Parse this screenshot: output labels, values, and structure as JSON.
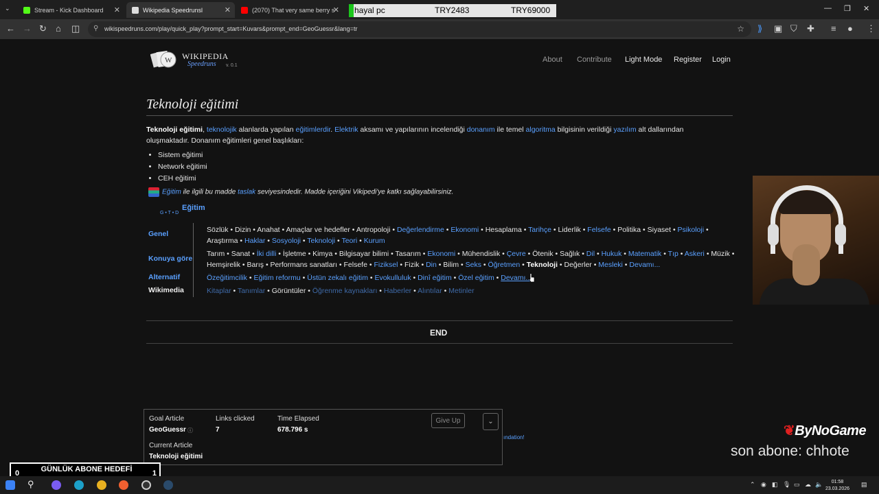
{
  "browser": {
    "tabs": [
      {
        "title": "Stream - Kick Dashboard",
        "favicon_color": "#53fc18"
      },
      {
        "title": "Wikipedia Speedrunsl",
        "favicon_color": "#dddddd"
      },
      {
        "title": "(2070) That very same berry sin",
        "favicon_color": "#ff0000"
      }
    ],
    "url": "wikispeedruns.com/play/quick_play?prompt_start=Kuvars&prompt_end=GeoGuessr&lang=tr"
  },
  "overlay_bar": {
    "label": "hayal pc",
    "value1": "TRY2483",
    "value2": "TRY69000"
  },
  "site": {
    "logo_title": "WIKIPEDIA",
    "logo_sub": "Speedruns",
    "version": "v. 0.1",
    "nav": [
      "About",
      "Contribute",
      "Light Mode",
      "Register",
      "Login"
    ]
  },
  "article": {
    "title": "Teknoloji eğitimi",
    "intro_line1": [
      {
        "t": "Teknoloji eğitimi",
        "s": "b"
      },
      {
        "t": ", "
      },
      {
        "t": "teknolojik",
        "s": "l"
      },
      {
        "t": " alanlarda yapılan "
      },
      {
        "t": "eğitimlerdir",
        "s": "l"
      },
      {
        "t": ". "
      },
      {
        "t": "Elektrik",
        "s": "l"
      },
      {
        "t": " aksamı ve yapılarının incelendiği "
      },
      {
        "t": "donanım",
        "s": "l"
      },
      {
        "t": " ile temel "
      },
      {
        "t": "algoritma",
        "s": "l"
      },
      {
        "t": " bilgisinin verildiği "
      },
      {
        "t": "yazılım",
        "s": "l"
      },
      {
        "t": " alt dallarından"
      }
    ],
    "intro_line2": "oluşmaktadır. Donanım eğitimleri genel başlıkları:",
    "bullets": [
      "Sistem eğitimi",
      "Network eğitimi",
      "CEH eğitimi"
    ],
    "stub": [
      {
        "t": "Eğitim",
        "s": "l"
      },
      {
        "t": " ile ilgili bu madde "
      },
      {
        "t": "taslak",
        "s": "l"
      },
      {
        "t": " seviyesindedir. Madde içeriğini Vikipedi'ye katkı sağlayabilirsiniz."
      }
    ],
    "navbox": {
      "title": "Eğitim",
      "vte": "G • T • D",
      "groups": [
        "Genel",
        "Konuya göre",
        "Alternatif",
        "Wikimedia"
      ],
      "lines": [
        [
          {
            "t": "Sözlük • Dizin • Anahat • Amaçlar ve hedefler • Antropoloji • "
          },
          {
            "t": "Değerlendirme",
            "s": "l"
          },
          {
            "t": " • "
          },
          {
            "t": "Ekonomi",
            "s": "l"
          },
          {
            "t": " • Hesaplama • "
          },
          {
            "t": "Tarihçe",
            "s": "l"
          },
          {
            "t": " • Liderlik • "
          },
          {
            "t": "Felsefe",
            "s": "l"
          },
          {
            "t": " • Politika • Siyaset • "
          },
          {
            "t": "Psikoloji",
            "s": "l"
          },
          {
            "t": " •"
          }
        ],
        [
          {
            "t": "Araştırma • "
          },
          {
            "t": "Haklar",
            "s": "l"
          },
          {
            "t": " • "
          },
          {
            "t": "Sosyoloji",
            "s": "l"
          },
          {
            "t": " • "
          },
          {
            "t": "Teknoloji",
            "s": "l"
          },
          {
            "t": " • "
          },
          {
            "t": "Teori",
            "s": "l"
          },
          {
            "t": " • "
          },
          {
            "t": "Kurum",
            "s": "l"
          }
        ],
        [
          {
            "t": "Tarım • Sanat • "
          },
          {
            "t": "İki dilli",
            "s": "l"
          },
          {
            "t": " • İşletme • Kimya • Bilgisayar bilimi • Tasarım • "
          },
          {
            "t": "Ekonomi",
            "s": "l"
          },
          {
            "t": " • Mühendislik • "
          },
          {
            "t": "Çevre",
            "s": "l"
          },
          {
            "t": " • Ötenik • Sağlık • "
          },
          {
            "t": "Dil",
            "s": "l"
          },
          {
            "t": " • "
          },
          {
            "t": "Hukuk",
            "s": "l"
          },
          {
            "t": " • "
          },
          {
            "t": "Matematik",
            "s": "l"
          },
          {
            "t": " • "
          },
          {
            "t": "Tıp",
            "s": "l"
          },
          {
            "t": " • "
          },
          {
            "t": "Askeri",
            "s": "l"
          },
          {
            "t": " • Müzik •"
          }
        ],
        [
          {
            "t": "Hemşirelik • Barış • Performans sanatları • Felsefe • "
          },
          {
            "t": "Fiziksel",
            "s": "l"
          },
          {
            "t": " • Fizik • "
          },
          {
            "t": "Din",
            "s": "l"
          },
          {
            "t": " • Bilim • "
          },
          {
            "t": "Seks",
            "s": "l"
          },
          {
            "t": " • "
          },
          {
            "t": "Öğretmen",
            "s": "l"
          },
          {
            "t": " • "
          },
          {
            "t": "Teknoloji",
            "s": "b"
          },
          {
            "t": " • Değerler • "
          },
          {
            "t": "Mesleki",
            "s": "l"
          },
          {
            "t": " • "
          },
          {
            "t": "Devamı...",
            "s": "l"
          }
        ],
        [
          {
            "t": "Özeğitimcilik",
            "s": "l"
          },
          {
            "t": " • "
          },
          {
            "t": "Eğitim reformu",
            "s": "l"
          },
          {
            "t": " • "
          },
          {
            "t": "Üstün zekalı eğitim",
            "s": "l"
          },
          {
            "t": " • "
          },
          {
            "t": "Evokulluluk",
            "s": "l"
          },
          {
            "t": " • "
          },
          {
            "t": "Dinî eğitim",
            "s": "l"
          },
          {
            "t": " • "
          },
          {
            "t": "Özel eğitim",
            "s": "l"
          },
          {
            "t": " • "
          },
          {
            "t": "Devamı...",
            "s": "u"
          }
        ],
        [
          {
            "t": "Kitaplar",
            "s": "d"
          },
          {
            "t": " • "
          },
          {
            "t": "Tanımlar",
            "s": "d"
          },
          {
            "t": " • Görüntüler • "
          },
          {
            "t": "Öğrenme kaynakları",
            "s": "d"
          },
          {
            "t": " • "
          },
          {
            "t": "Haberler",
            "s": "d"
          },
          {
            "t": " • "
          },
          {
            "t": "Alıntılar",
            "s": "d"
          },
          {
            "t": " • "
          },
          {
            "t": "Metinler",
            "s": "d"
          }
        ]
      ]
    },
    "end_label": "END"
  },
  "game_panel": {
    "goal_label": "Goal Article",
    "goal_value": "GeoGuessr",
    "links_label": "Links clicked",
    "links_value": "7",
    "time_label": "Time Elapsed",
    "time_value": "678.796 s",
    "current_label": "Current Article",
    "current_value": "Teknoloji eğitimi",
    "give_up": "Give Up",
    "footer_fragment": "ındation!"
  },
  "stream_overlay": {
    "brand": "ByNoGame",
    "last_sub": "son abone: chhote",
    "sub_goal_label": "GÜNLÜK ABONE HEDEFİ",
    "sub_goal_current": "0",
    "sub_goal_target": "1"
  },
  "taskbar": {
    "time": "01:58",
    "date": "23.03.2026"
  }
}
